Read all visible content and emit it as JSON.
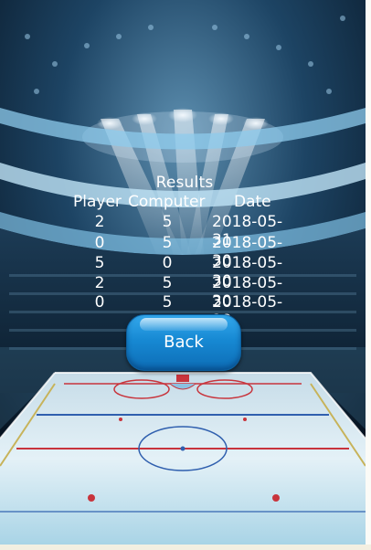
{
  "results": {
    "title": "Results",
    "columns": {
      "player": "Player",
      "computer": "Computer",
      "date": "Date"
    },
    "rows": [
      {
        "player": "2",
        "computer": "5",
        "date": "2018-05-31"
      },
      {
        "player": "0",
        "computer": "5",
        "date": "2018-05-30"
      },
      {
        "player": "5",
        "computer": "0",
        "date": "2018-05-30"
      },
      {
        "player": "2",
        "computer": "5",
        "date": "2018-05-30"
      },
      {
        "player": "0",
        "computer": "5",
        "date": "2018-05-29"
      }
    ]
  },
  "back_button": {
    "label": "Back",
    "color": "#1a8ad6"
  },
  "colors": {
    "text": "#ffffff",
    "ice": "#dcecf4",
    "rink_red_line": "#c8343c",
    "rink_blue_line": "#2f5fae"
  }
}
